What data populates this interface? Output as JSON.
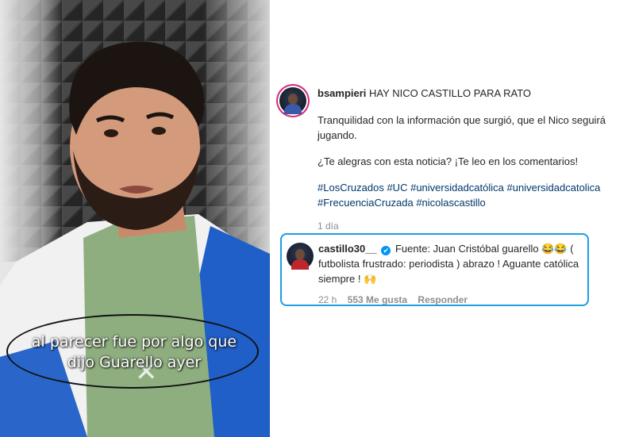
{
  "video": {
    "caption_line1": "al parecer fue por algo que",
    "caption_line2": "dijo Guarello ayer"
  },
  "post": {
    "username": "bsampieri",
    "headline": "HAY NICO CASTILLO PARA RATO",
    "paragraph1": "Tranquilidad con la información que surgió, que el Nico seguirá jugando.",
    "paragraph2": "¿Te alegras con esta noticia? ¡Te leo en los comentarios!",
    "hashtags": [
      "#LosCruzados",
      "#UC",
      "#universidadcatólica",
      "#universidadcatolica",
      "#FrecuenciaCruzada",
      "#nicolascastillo"
    ],
    "time_ago": "1 día"
  },
  "comment": {
    "username": "castillo30__",
    "verified_icon": "✔",
    "text": "Fuente: Juan Cristóbal guarello 😂😂 ( futbolista frustrado: periodista ) abrazo ! Aguante católica siempre ! 🙌",
    "time_ago": "22 h",
    "likes": "553 Me gusta",
    "reply_label": "Responder"
  },
  "colors": {
    "highlight_box": "#1e9ee0",
    "hashtag_link": "#00376b",
    "muted": "#8e8e8e",
    "story_ring": "#d62976"
  }
}
